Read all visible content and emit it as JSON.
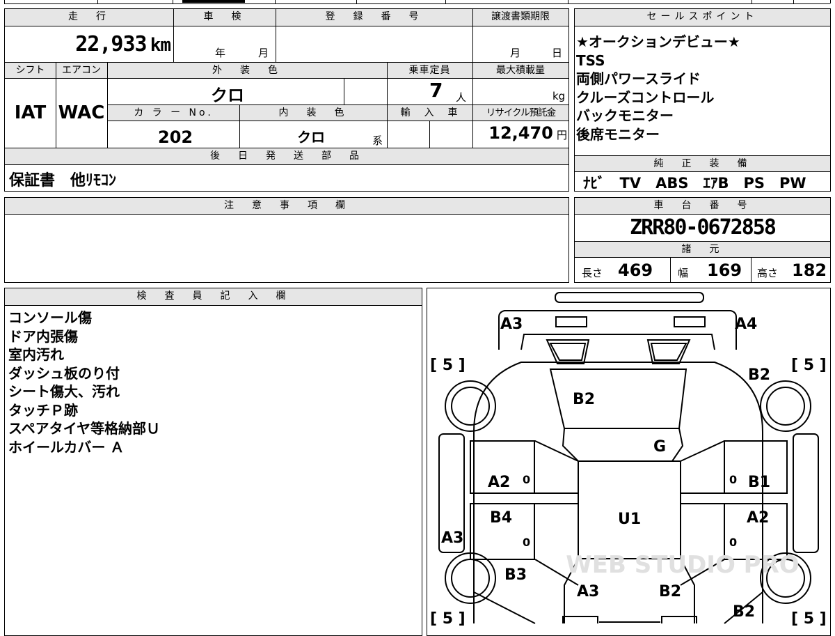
{
  "main": {
    "labels": {
      "mileage": "走　行",
      "inspection": "車　検",
      "registration_no": "登　録　番　号",
      "transfer_deadline": "譲渡書類期限",
      "shift": "シフト",
      "aircon": "エアコン",
      "exterior_color": "外　装　色",
      "capacity": "乗車定員",
      "max_load": "最大積載量",
      "color_no": "カ ラ ー No.",
      "interior_color": "内　装　色",
      "imported": "輸　入　車",
      "recycle_fee": "リサイクル預託金",
      "later_shipped": "後　日　発　送　部　品"
    },
    "mileage_value": "22,933",
    "mileage_unit": "km",
    "inspection_year": "年",
    "inspection_month": "月",
    "deadline_month": "月",
    "deadline_day": "日",
    "shift_value": "IAT",
    "aircon_value": "WAC",
    "exterior_color_value": "クロ",
    "capacity_value": "7",
    "capacity_unit": "人",
    "max_load_unit": "kg",
    "color_no_value": "202",
    "interior_color_value": "クロ",
    "interior_color_suffix": "系",
    "recycle_fee_value": "12,470",
    "recycle_fee_unit": "円",
    "later_shipped_value": "保証書　他ﾘﾓｺﾝ"
  },
  "sales_points": {
    "header": "セールスポイント",
    "items": [
      "★オークションデビュー★",
      "TSS",
      "両側パワースライド",
      "クルーズコントロール",
      "バックモニター",
      "後席モニター"
    ]
  },
  "genuine_equipment": {
    "header": "純　正　装　備",
    "value": "ﾅﾋﾞ　TV　ABS　ｴｱB　PS　PW"
  },
  "notes": {
    "header": "注　意　事　項　欄"
  },
  "chassis": {
    "header": "車　台　番　号",
    "value": "ZRR80-0672858"
  },
  "specs": {
    "header": "諸　元",
    "length_label": "長さ",
    "length_value": "469",
    "width_label": "幅",
    "width_value": "169",
    "height_label": "高さ",
    "height_value": "182"
  },
  "inspector": {
    "header": "検　査　員　記　入　欄",
    "items": [
      "コンソール傷",
      "ドア内張傷",
      "室内汚れ",
      "ダッシュ板のり付",
      "シート傷大、汚れ",
      "タッチＰ跡",
      "スペアタイヤ等格納部Ｕ",
      "ホイールカバー Ａ"
    ]
  },
  "diagram": {
    "watermark": "WEB STUDIO PRO",
    "tire_fl": "[ 5 ]",
    "tire_fr": "[ 5 ]",
    "tire_rl": "[ 5 ]",
    "tire_rr": "[ 5 ]",
    "marks": {
      "front_left_corner": "A3",
      "front_right_corner": "A4",
      "hood": "B2",
      "right_fender": "B2",
      "windshield": "G",
      "left_front_door": "A2",
      "right_front_door": "B1",
      "left_rear_door": "B4",
      "right_rear_door": "A2",
      "roof": "U1",
      "left_side": "A3",
      "left_rear_quarter": "B3",
      "rear_gate_left": "A3",
      "rear_gate_right": "B2",
      "right_rear_quarter": "B2"
    },
    "door_marks": {
      "lf": "0",
      "rf": "0",
      "lr": "0",
      "rr": "0"
    }
  }
}
